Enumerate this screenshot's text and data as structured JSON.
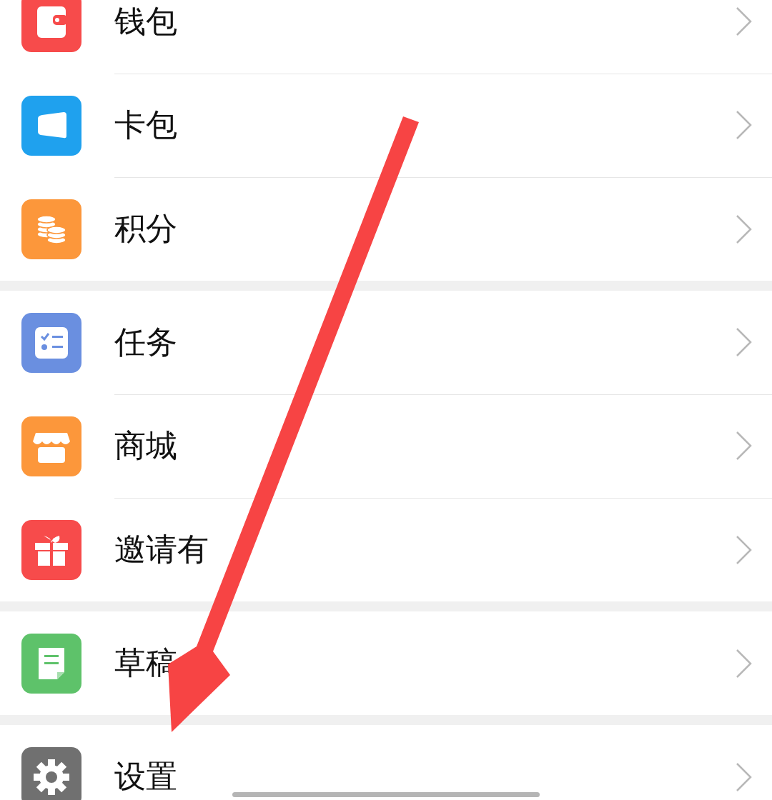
{
  "groups": [
    {
      "items": [
        {
          "label": "钱包",
          "kind": "wallet",
          "color": "#f74b4b"
        },
        {
          "label": "卡包",
          "kind": "card",
          "color": "#1fa1ee"
        },
        {
          "label": "积分",
          "kind": "coins",
          "color": "#fc973b"
        }
      ]
    },
    {
      "items": [
        {
          "label": "任务",
          "kind": "tasks",
          "color": "#6a8fe0"
        },
        {
          "label": "商城",
          "kind": "shop",
          "color": "#fc973b"
        },
        {
          "label": "邀请有",
          "kind": "gift",
          "color": "#f74b4b"
        }
      ]
    },
    {
      "items": [
        {
          "label": "草稿",
          "kind": "draft",
          "color": "#5ec26a"
        }
      ]
    },
    {
      "items": [
        {
          "label": "设置",
          "kind": "gear",
          "color": "#707070"
        }
      ]
    }
  ]
}
